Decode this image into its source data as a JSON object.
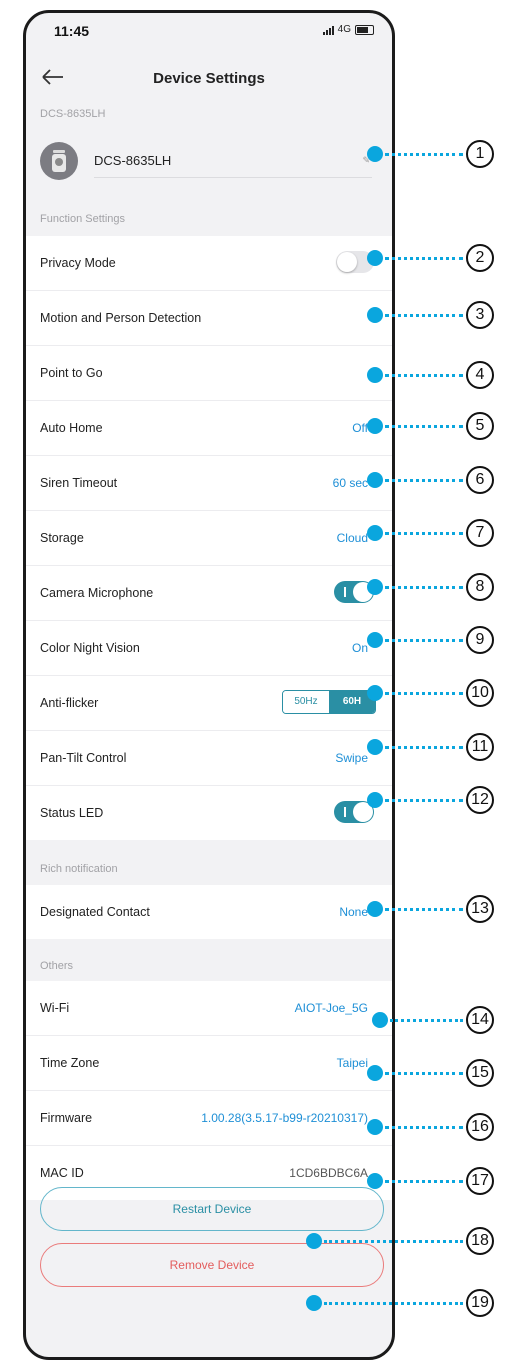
{
  "status_bar": {
    "time": "11:45",
    "network": "4G"
  },
  "nav": {
    "title": "Device Settings"
  },
  "device": {
    "section_label": "DCS-8635LH",
    "name": "DCS-8635LH"
  },
  "function_settings": {
    "section_label": "Function Settings",
    "privacy_mode": {
      "label": "Privacy Mode",
      "state": "off"
    },
    "motion_detection": {
      "label": "Motion and Person Detection"
    },
    "point_to_go": {
      "label": "Point to Go"
    },
    "auto_home": {
      "label": "Auto Home",
      "value": "Off"
    },
    "siren_timeout": {
      "label": "Siren Timeout",
      "value": "60 sec"
    },
    "storage": {
      "label": "Storage",
      "value": "Cloud"
    },
    "camera_microphone": {
      "label": "Camera Microphone",
      "state": "on"
    },
    "color_night_vision": {
      "label": "Color Night Vision",
      "value": "On"
    },
    "anti_flicker": {
      "label": "Anti-flicker",
      "options": [
        "50Hz",
        "60H"
      ],
      "selected": "60H"
    },
    "pan_tilt": {
      "label": "Pan-Tilt Control",
      "value": "Swipe"
    },
    "status_led": {
      "label": "Status LED",
      "state": "on"
    }
  },
  "rich_notification": {
    "section_label": "Rich notification",
    "designated_contact": {
      "label": "Designated Contact",
      "value": "None"
    }
  },
  "others": {
    "section_label": "Others",
    "wifi": {
      "label": "Wi-Fi",
      "value": "AIOT-Joe_5G"
    },
    "time_zone": {
      "label": "Time Zone",
      "value": "Taipei"
    },
    "firmware": {
      "label": "Firmware",
      "value": "1.00.28(3.5.17-b99-r20210317)"
    },
    "mac_id": {
      "label": "MAC ID",
      "value": "1CD6BDBC6A"
    }
  },
  "buttons": {
    "restart": "Restart Device",
    "remove": "Remove Device"
  },
  "callouts": [
    "1",
    "2",
    "3",
    "4",
    "5",
    "6",
    "7",
    "8",
    "9",
    "10",
    "11",
    "12",
    "13",
    "14",
    "15",
    "16",
    "17",
    "18",
    "19"
  ],
  "colors": {
    "accent": "#2a8fa4",
    "link": "#1e8fd6",
    "callout": "#0aa6de",
    "danger": "#e35d5d"
  }
}
